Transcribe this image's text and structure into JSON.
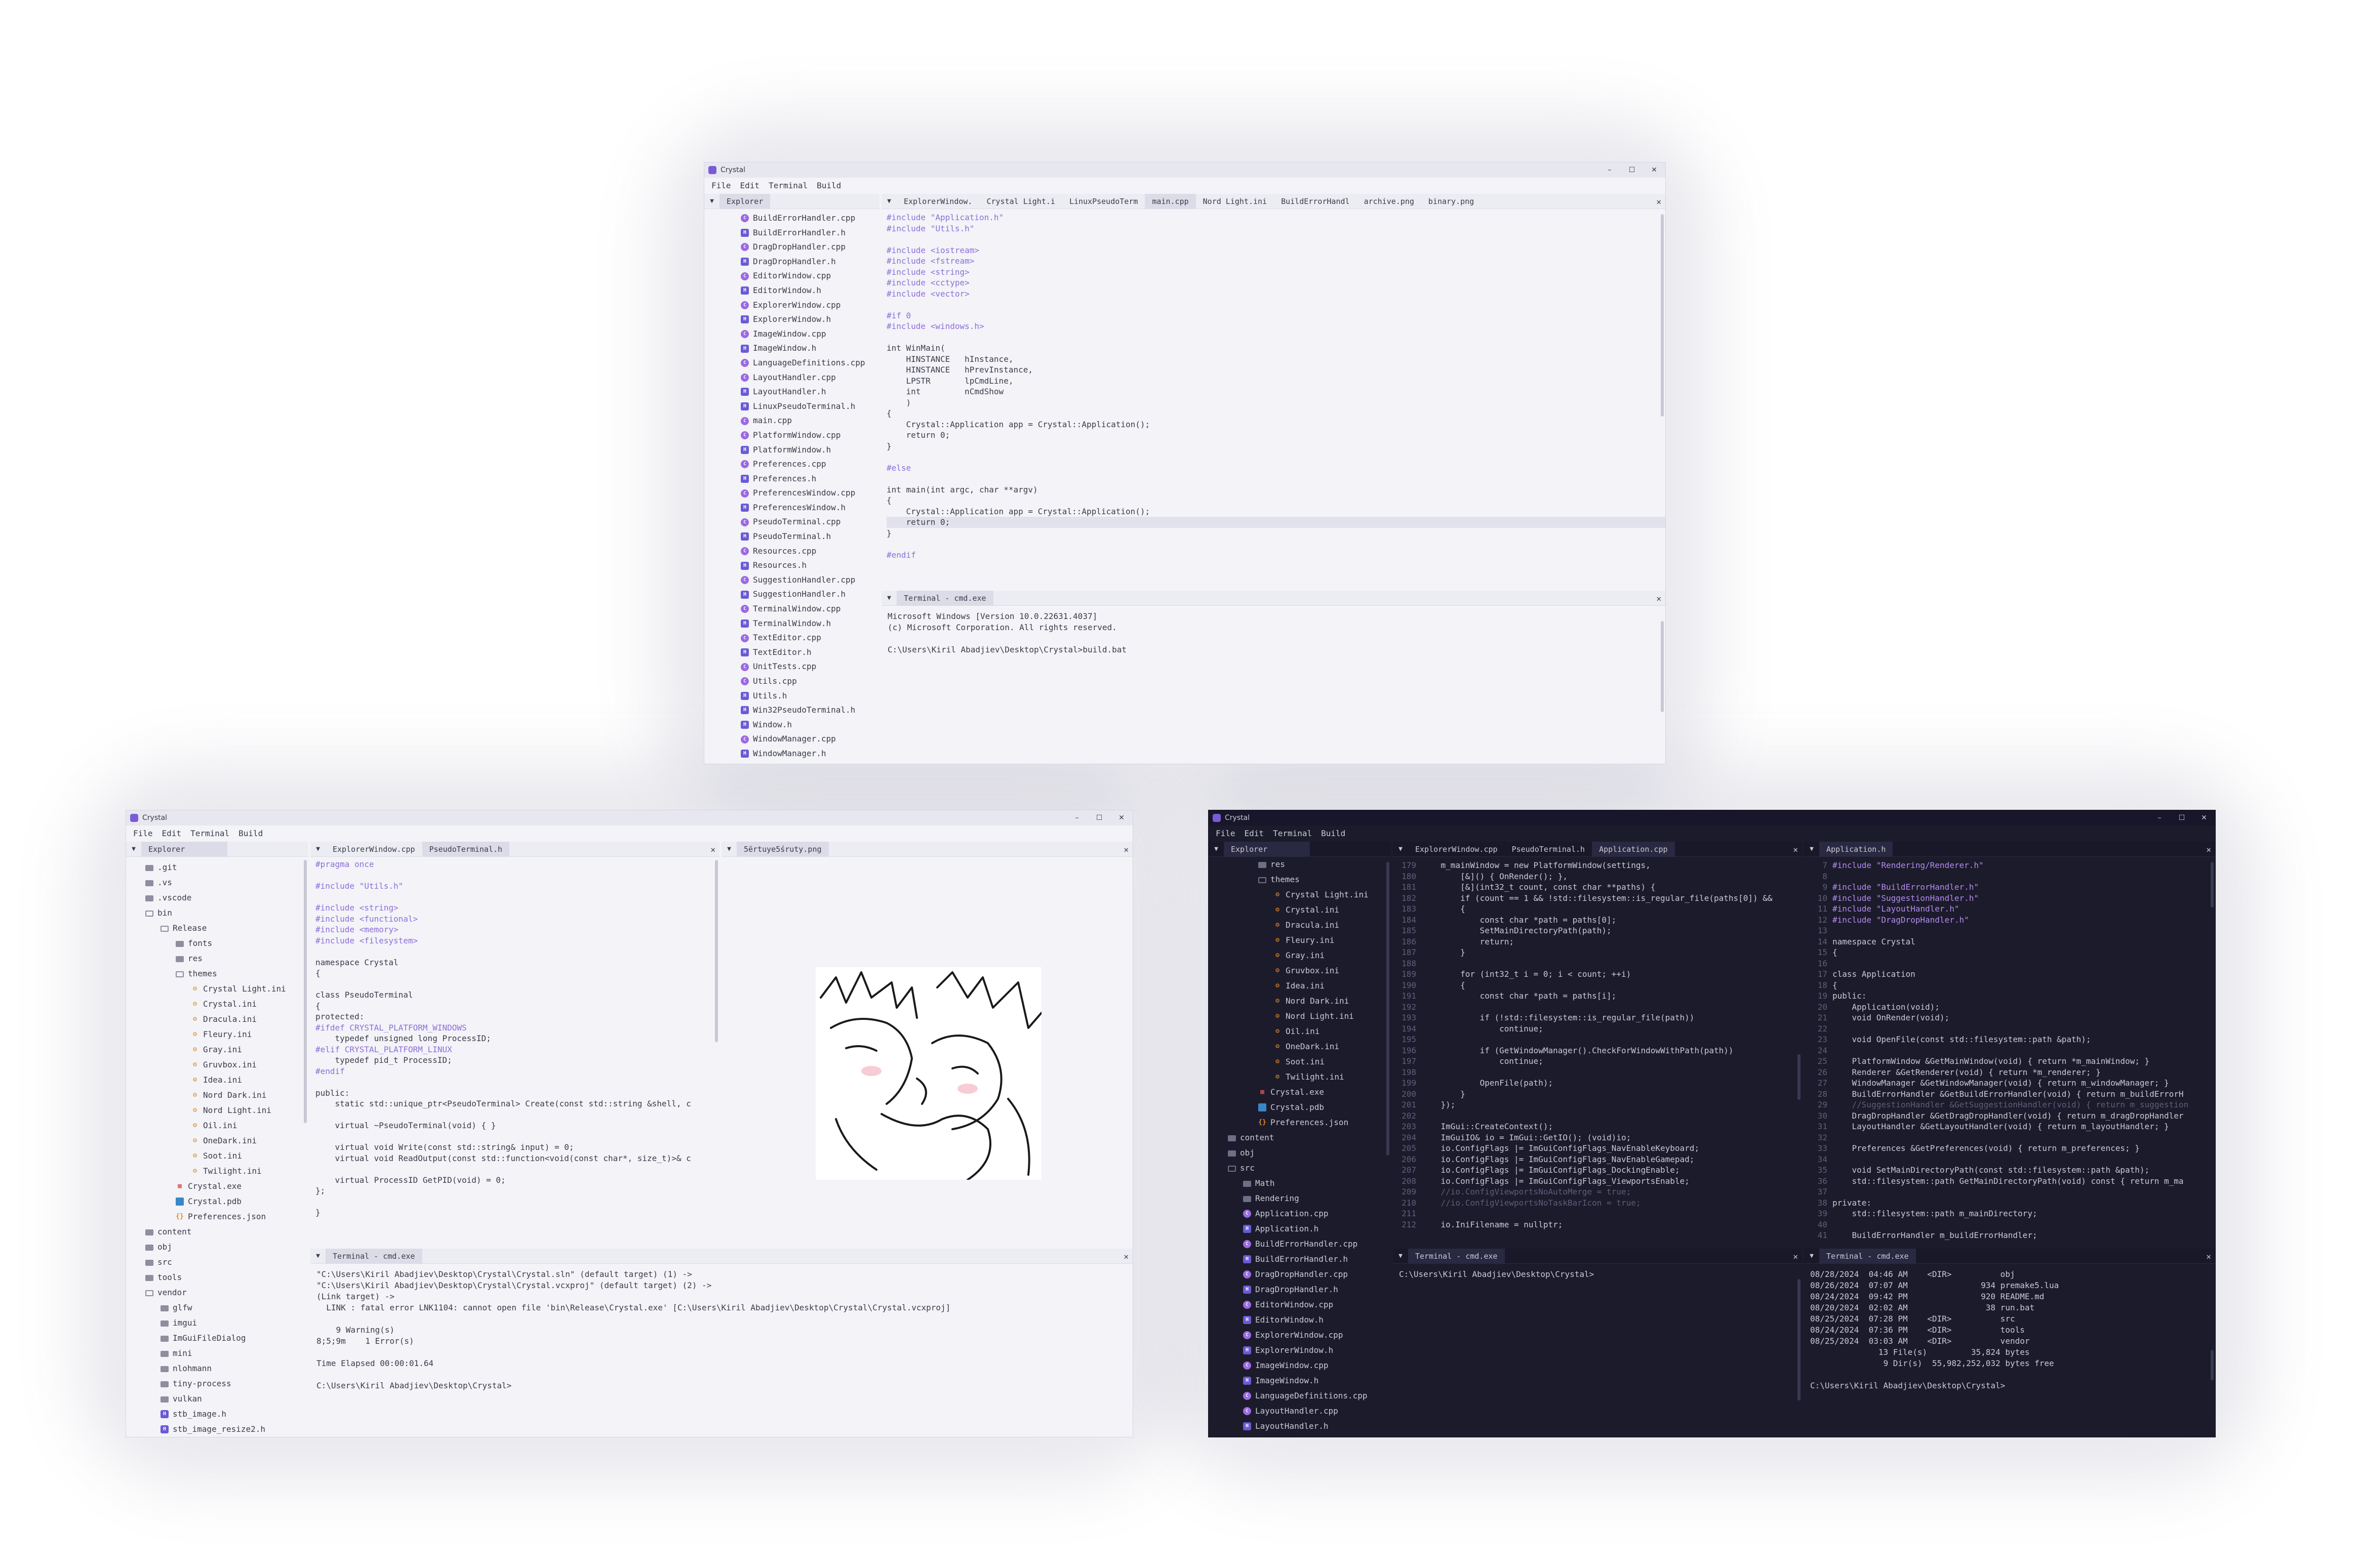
{
  "app_title": "Crystal",
  "menu": [
    "File",
    "Edit",
    "Terminal",
    "Build"
  ],
  "window_controls": {
    "minimize": "–",
    "maximize": "☐",
    "close": "✕"
  },
  "explorer_label": "Explorer",
  "win1": {
    "tabs": [
      "ExplorerWindow.",
      "Crystal Light.i",
      "LinuxPseudoTerm",
      "main.cpp",
      "Nord Light.ini",
      "BuildErrorHandl",
      "archive.png",
      "binary.png"
    ],
    "files": [
      "BuildErrorHandler.cpp",
      "BuildErrorHandler.h",
      "DragDropHandler.cpp",
      "DragDropHandler.h",
      "EditorWindow.cpp",
      "EditorWindow.h",
      "ExplorerWindow.cpp",
      "ExplorerWindow.h",
      "ImageWindow.cpp",
      "ImageWindow.h",
      "LanguageDefinitions.cpp",
      "LayoutHandler.cpp",
      "LayoutHandler.h",
      "LinuxPseudoTerminal.h",
      "main.cpp",
      "PlatformWindow.cpp",
      "PlatformWindow.h",
      "Preferences.cpp",
      "Preferences.h",
      "PreferencesWindow.cpp",
      "PreferencesWindow.h",
      "PseudoTerminal.cpp",
      "PseudoTerminal.h",
      "Resources.cpp",
      "Resources.h",
      "SuggestionHandler.cpp",
      "SuggestionHandler.h",
      "TerminalWindow.cpp",
      "TerminalWindow.h",
      "TextEditor.cpp",
      "TextEditor.h",
      "UnitTests.cpp",
      "Utils.cpp",
      "Utils.h",
      "Win32PseudoTerminal.h",
      "Window.h",
      "WindowManager.cpp",
      "WindowManager.h"
    ],
    "code": [
      "#include \"Application.h\"",
      "#include \"Utils.h\"",
      "",
      "#include <iostream>",
      "#include <fstream>",
      "#include <string>",
      "#include <cctype>",
      "#include <vector>",
      "",
      "#if 0",
      "#include <windows.h>",
      "",
      "int WinMain(",
      "    HINSTANCE   hInstance,",
      "    HINSTANCE   hPrevInstance,",
      "    LPSTR       lpCmdLine,",
      "    int         nCmdShow",
      "    )",
      "{",
      "    Crystal::Application app = Crystal::Application();",
      "    return 0;",
      "}",
      "",
      "#else",
      "",
      "int main(int argc, char **argv)",
      "{",
      "    Crystal::Application app = Crystal::Application();",
      "    return 0;",
      "}",
      "",
      "#endif"
    ],
    "terminal_title": "Terminal - cmd.exe",
    "terminal_lines": [
      "Microsoft Windows [Version 10.0.22631.4037]",
      "(c) Microsoft Corporation. All rights reserved.",
      "",
      "C:\\Users\\Kiril Abadjiev\\Desktop\\Crystal>build.bat"
    ]
  },
  "win2": {
    "tree": [
      {
        "name": ".git",
        "icon": "folder",
        "depth": 0
      },
      {
        "name": ".vs",
        "icon": "folder",
        "depth": 0
      },
      {
        "name": ".vscode",
        "icon": "folder",
        "depth": 0
      },
      {
        "name": "bin",
        "icon": "folder-open",
        "depth": 0
      },
      {
        "name": "Release",
        "icon": "folder-open",
        "depth": 1
      },
      {
        "name": "fonts",
        "icon": "folder",
        "depth": 2
      },
      {
        "name": "res",
        "icon": "folder",
        "depth": 2
      },
      {
        "name": "themes",
        "icon": "folder-open",
        "depth": 2
      },
      {
        "name": "Crystal Light.ini",
        "icon": "ini",
        "depth": 3
      },
      {
        "name": "Crystal.ini",
        "icon": "ini",
        "depth": 3
      },
      {
        "name": "Dracula.ini",
        "icon": "ini",
        "depth": 3
      },
      {
        "name": "Fleury.ini",
        "icon": "ini",
        "depth": 3
      },
      {
        "name": "Gray.ini",
        "icon": "ini",
        "depth": 3
      },
      {
        "name": "Gruvbox.ini",
        "icon": "ini",
        "depth": 3
      },
      {
        "name": "Idea.ini",
        "icon": "ini",
        "depth": 3
      },
      {
        "name": "Nord Dark.ini",
        "icon": "ini",
        "depth": 3
      },
      {
        "name": "Nord Light.ini",
        "icon": "ini",
        "depth": 3
      },
      {
        "name": "Oil.ini",
        "icon": "ini",
        "depth": 3
      },
      {
        "name": "OneDark.ini",
        "icon": "ini",
        "depth": 3
      },
      {
        "name": "Soot.ini",
        "icon": "ini",
        "depth": 3
      },
      {
        "name": "Twilight.ini",
        "icon": "ini",
        "depth": 3
      },
      {
        "name": "Crystal.exe",
        "icon": "exe",
        "depth": 2
      },
      {
        "name": "Crystal.pdb",
        "icon": "pdb",
        "depth": 2
      },
      {
        "name": "Preferences.json",
        "icon": "json",
        "depth": 2
      },
      {
        "name": "content",
        "icon": "folder",
        "depth": 0
      },
      {
        "name": "obj",
        "icon": "folder",
        "depth": 0
      },
      {
        "name": "src",
        "icon": "folder",
        "depth": 0
      },
      {
        "name": "tools",
        "icon": "folder",
        "depth": 0
      },
      {
        "name": "vendor",
        "icon": "folder-open",
        "depth": 0
      },
      {
        "name": "glfw",
        "icon": "folder",
        "depth": 1
      },
      {
        "name": "imgui",
        "icon": "folder",
        "depth": 1
      },
      {
        "name": "ImGuiFileDialog",
        "icon": "folder",
        "depth": 1
      },
      {
        "name": "mini",
        "icon": "folder",
        "depth": 1
      },
      {
        "name": "nlohmann",
        "icon": "folder",
        "depth": 1
      },
      {
        "name": "tiny-process",
        "icon": "folder",
        "depth": 1
      },
      {
        "name": "vulkan",
        "icon": "folder",
        "depth": 1
      },
      {
        "name": "stb_image.h",
        "icon": "h",
        "depth": 1
      },
      {
        "name": "stb_image_resize2.h",
        "icon": "h",
        "depth": 1
      }
    ],
    "tabs": [
      "ExplorerWindow.cpp",
      "PseudoTerminal.h"
    ],
    "image_tab": "5ërtuye5śruty.png",
    "code": [
      "#pragma once",
      "",
      "#include \"Utils.h\"",
      "",
      "#include <string>",
      "#include <functional>",
      "#include <memory>",
      "#include <filesystem>",
      "",
      "namespace Crystal",
      "{",
      "",
      "class PseudoTerminal",
      "{",
      "protected:",
      "#ifdef CRYSTAL_PLATFORM_WINDOWS",
      "    typedef unsigned long ProcessID;",
      "#elif CRYSTAL_PLATFORM_LINUX",
      "    typedef pid_t ProcessID;",
      "#endif",
      "",
      "public:",
      "    static std::unique_ptr<PseudoTerminal> Create(const std::string &shell, c",
      "",
      "    virtual ~PseudoTerminal(void) { }",
      "",
      "    virtual void Write(const std::string& input) = 0;",
      "    virtual void ReadOutput(const std::function<void(const char*, size_t)>& c",
      "",
      "    virtual ProcessID GetPID(void) = 0;",
      "};",
      "",
      "}"
    ],
    "terminal_title": "Terminal - cmd.exe",
    "terminal_lines": [
      "\"C:\\Users\\Kiril Abadjiev\\Desktop\\Crystal\\Crystal.sln\" (default target) (1) ->",
      "\"C:\\Users\\Kiril Abadjiev\\Desktop\\Crystal\\Crystal.vcxproj\" (default target) (2) ->",
      "(Link target) ->",
      "  LINK : fatal error LNK1104: cannot open file 'bin\\Release\\Crystal.exe' [C:\\Users\\Kiril Abadjiev\\Desktop\\Crystal\\Crystal.vcxproj]",
      "",
      "    9 Warning(s)",
      "8;5;9m    1 Error(s)",
      "",
      "Time Elapsed 00:00:01.64",
      "",
      "C:\\Users\\Kiril Abadjiev\\Desktop\\Crystal>"
    ]
  },
  "win3": {
    "tree": [
      {
        "name": "res",
        "icon": "folder",
        "depth": 2
      },
      {
        "name": "themes",
        "icon": "folder-open",
        "depth": 2
      },
      {
        "name": "Crystal Light.ini",
        "icon": "ini",
        "depth": 3
      },
      {
        "name": "Crystal.ini",
        "icon": "ini",
        "depth": 3
      },
      {
        "name": "Dracula.ini",
        "icon": "ini",
        "depth": 3
      },
      {
        "name": "Fleury.ini",
        "icon": "ini",
        "depth": 3
      },
      {
        "name": "Gray.ini",
        "icon": "ini",
        "depth": 3
      },
      {
        "name": "Gruvbox.ini",
        "icon": "ini",
        "depth": 3
      },
      {
        "name": "Idea.ini",
        "icon": "ini",
        "depth": 3
      },
      {
        "name": "Nord Dark.ini",
        "icon": "ini",
        "depth": 3
      },
      {
        "name": "Nord Light.ini",
        "icon": "ini",
        "depth": 3
      },
      {
        "name": "Oil.ini",
        "icon": "ini",
        "depth": 3
      },
      {
        "name": "OneDark.ini",
        "icon": "ini",
        "depth": 3
      },
      {
        "name": "Soot.ini",
        "icon": "ini",
        "depth": 3
      },
      {
        "name": "Twilight.ini",
        "icon": "ini",
        "depth": 3
      },
      {
        "name": "Crystal.exe",
        "icon": "exe",
        "depth": 2
      },
      {
        "name": "Crystal.pdb",
        "icon": "pdb",
        "depth": 2
      },
      {
        "name": "Preferences.json",
        "icon": "json",
        "depth": 2
      },
      {
        "name": "content",
        "icon": "folder",
        "depth": 0
      },
      {
        "name": "obj",
        "icon": "folder",
        "depth": 0
      },
      {
        "name": "src",
        "icon": "folder-open",
        "depth": 0
      },
      {
        "name": "Math",
        "icon": "folder",
        "depth": 1
      },
      {
        "name": "Rendering",
        "icon": "folder",
        "depth": 1
      },
      {
        "name": "Application.cpp",
        "icon": "cpp",
        "depth": 1
      },
      {
        "name": "Application.h",
        "icon": "h",
        "depth": 1
      },
      {
        "name": "BuildErrorHandler.cpp",
        "icon": "cpp",
        "depth": 1
      },
      {
        "name": "BuildErrorHandler.h",
        "icon": "h",
        "depth": 1
      },
      {
        "name": "DragDropHandler.cpp",
        "icon": "cpp",
        "depth": 1
      },
      {
        "name": "DragDropHandler.h",
        "icon": "h",
        "depth": 1
      },
      {
        "name": "EditorWindow.cpp",
        "icon": "cpp",
        "depth": 1
      },
      {
        "name": "EditorWindow.h",
        "icon": "h",
        "depth": 1
      },
      {
        "name": "ExplorerWindow.cpp",
        "icon": "cpp",
        "depth": 1
      },
      {
        "name": "ExplorerWindow.h",
        "icon": "h",
        "depth": 1
      },
      {
        "name": "ImageWindow.cpp",
        "icon": "cpp",
        "depth": 1
      },
      {
        "name": "ImageWindow.h",
        "icon": "h",
        "depth": 1
      },
      {
        "name": "LanguageDefinitions.cpp",
        "icon": "cpp",
        "depth": 1
      },
      {
        "name": "LayoutHandler.cpp",
        "icon": "cpp",
        "depth": 1
      },
      {
        "name": "LayoutHandler.h",
        "icon": "h",
        "depth": 1
      }
    ],
    "tabs": [
      "ExplorerWindow.cpp",
      "PseudoTerminal.h",
      "Application.cpp"
    ],
    "code_lines": [
      {
        "n": "179",
        "t": "    m_mainWindow = new PlatformWindow(settings,"
      },
      {
        "n": "180",
        "t": "        [&]() { OnRender(); },"
      },
      {
        "n": "181",
        "t": "        [&](int32_t count, const char **paths) {"
      },
      {
        "n": "182",
        "t": "        if (count == 1 && !std::filesystem::is_regular_file(paths[0]) &&"
      },
      {
        "n": "183",
        "t": "        {"
      },
      {
        "n": "184",
        "t": "            const char *path = paths[0];"
      },
      {
        "n": "185",
        "t": "            SetMainDirectoryPath(path);"
      },
      {
        "n": "186",
        "t": "            return;"
      },
      {
        "n": "187",
        "t": "        }"
      },
      {
        "n": "188",
        "t": ""
      },
      {
        "n": "189",
        "t": "        for (int32_t i = 0; i < count; ++i)"
      },
      {
        "n": "190",
        "t": "        {"
      },
      {
        "n": "191",
        "t": "            const char *path = paths[i];"
      },
      {
        "n": "192",
        "t": ""
      },
      {
        "n": "193",
        "t": "            if (!std::filesystem::is_regular_file(path))"
      },
      {
        "n": "194",
        "t": "                continue;"
      },
      {
        "n": "195",
        "t": ""
      },
      {
        "n": "196",
        "t": "            if (GetWindowManager().CheckForWindowWithPath(path))"
      },
      {
        "n": "197",
        "t": "                continue;"
      },
      {
        "n": "198",
        "t": ""
      },
      {
        "n": "199",
        "t": "            OpenFile(path);"
      },
      {
        "n": "200",
        "t": "        }"
      },
      {
        "n": "201",
        "t": "    });"
      },
      {
        "n": "202",
        "t": ""
      },
      {
        "n": "203",
        "t": "    ImGui::CreateContext();"
      },
      {
        "n": "204",
        "t": "    ImGuiIO& io = ImGui::GetIO(); (void)io;"
      },
      {
        "n": "205",
        "t": "    io.ConfigFlags |= ImGuiConfigFlags_NavEnableKeyboard;"
      },
      {
        "n": "206",
        "t": "    io.ConfigFlags |= ImGuiConfigFlags_NavEnableGamepad;"
      },
      {
        "n": "207",
        "t": "    io.ConfigFlags |= ImGuiConfigFlags_DockingEnable;"
      },
      {
        "n": "208",
        "t": "    io.ConfigFlags |= ImGuiConfigFlags_ViewportsEnable;"
      },
      {
        "n": "209",
        "t": "    //io.ConfigViewportsNoAutoMerge = true;"
      },
      {
        "n": "210",
        "t": "    //io.ConfigViewportsNoTaskBarIcon = true;"
      },
      {
        "n": "211",
        "t": ""
      },
      {
        "n": "212",
        "t": "    io.IniFilename = nullptr;"
      }
    ],
    "right_tab": "Application.h",
    "right_lines": [
      {
        "n": "7",
        "t": "#include \"Rendering/Renderer.h\""
      },
      {
        "n": "8",
        "t": ""
      },
      {
        "n": "9",
        "t": "#include \"BuildErrorHandler.h\""
      },
      {
        "n": "10",
        "t": "#include \"SuggestionHandler.h\""
      },
      {
        "n": "11",
        "t": "#include \"LayoutHandler.h\""
      },
      {
        "n": "12",
        "t": "#include \"DragDropHandler.h\""
      },
      {
        "n": "13",
        "t": ""
      },
      {
        "n": "14",
        "t": "namespace Crystal"
      },
      {
        "n": "15",
        "t": "{"
      },
      {
        "n": "16",
        "t": ""
      },
      {
        "n": "17",
        "t": "class Application"
      },
      {
        "n": "18",
        "t": "{"
      },
      {
        "n": "19",
        "t": "public:"
      },
      {
        "n": "20",
        "t": "    Application(void);"
      },
      {
        "n": "21",
        "t": "    void OnRender(void);"
      },
      {
        "n": "22",
        "t": ""
      },
      {
        "n": "23",
        "t": "    void OpenFile(const std::filesystem::path &path);"
      },
      {
        "n": "24",
        "t": ""
      },
      {
        "n": "25",
        "t": "    PlatformWindow &GetMainWindow(void) { return *m_mainWindow; }"
      },
      {
        "n": "26",
        "t": "    Renderer &GetRenderer(void) { return *m_renderer; }"
      },
      {
        "n": "27",
        "t": "    WindowManager &GetWindowManager(void) { return m_windowManager; }"
      },
      {
        "n": "28",
        "t": "    BuildErrorHandler &GetBuildErrorHandler(void) { return m_buildErrorH"
      },
      {
        "n": "29",
        "t": "    //SuggestionHandler &GetSuggestionHandler(void) { return m_suggestion"
      },
      {
        "n": "30",
        "t": "    DragDropHandler &GetDragDropHandler(void) { return m_dragDropHandler"
      },
      {
        "n": "31",
        "t": "    LayoutHandler &GetLayoutHandler(void) { return m_layoutHandler; }"
      },
      {
        "n": "32",
        "t": ""
      },
      {
        "n": "33",
        "t": "    Preferences &GetPreferences(void) { return m_preferences; }"
      },
      {
        "n": "34",
        "t": ""
      },
      {
        "n": "35",
        "t": "    void SetMainDirectoryPath(const std::filesystem::path &path);"
      },
      {
        "n": "36",
        "t": "    std::filesystem::path GetMainDirectoryPath(void) const { return m_ma"
      },
      {
        "n": "37",
        "t": ""
      },
      {
        "n": "38",
        "t": "private:"
      },
      {
        "n": "39",
        "t": "    std::filesystem::path m_mainDirectory;"
      },
      {
        "n": "40",
        "t": ""
      },
      {
        "n": "41",
        "t": "    BuildErrorHandler m_buildErrorHandler;"
      }
    ],
    "terminal_title": "Terminal - cmd.exe",
    "terminal_left_lines": [
      "C:\\Users\\Kiril Abadjiev\\Desktop\\Crystal>"
    ],
    "terminal_right_lines": [
      "08/28/2024  04:46 AM    <DIR>          obj",
      "08/26/2024  07:07 AM               934 premake5.lua",
      "08/24/2024  09:42 PM               920 README.md",
      "08/20/2024  02:02 AM                38 run.bat",
      "08/25/2024  07:28 PM    <DIR>          src",
      "08/24/2024  07:36 PM    <DIR>          tools",
      "08/25/2024  03:03 AM    <DIR>          vendor",
      "              13 File(s)         35,824 bytes",
      "               9 Dir(s)  55,982,252,032 bytes free",
      "",
      "C:\\Users\\Kiril Abadjiev\\Desktop\\Crystal>"
    ]
  }
}
